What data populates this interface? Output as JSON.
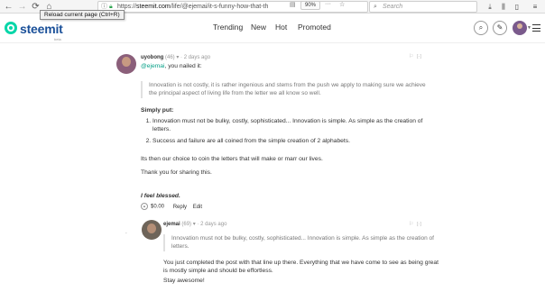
{
  "browser": {
    "url_prefix": "https://",
    "url_domain": "steemit.com",
    "url_path": "/life/@ejemai/it-s-funny-how-that-th",
    "zoom": "90%",
    "menu_dots": "···",
    "search_placeholder": "Search",
    "tooltip": "Reload current page (Ctrl+R)"
  },
  "header": {
    "logo": "steemit",
    "beta": "beta",
    "nav": [
      "Trending",
      "New",
      "Hot",
      "Promoted"
    ]
  },
  "comment1": {
    "author": "uyobong",
    "reputation": "(46)",
    "time": "2 days ago",
    "mention": "@ejemai",
    "greeting_rest": ", you nailed it:",
    "quote": "Innovation is not costly, it is rather ingenious and stems from the push we apply to making sure we achieve the principal aspect of living life from the letter we all know so well.",
    "simply_put": "Simply put:",
    "points": [
      "Innovation must not be bulky, costly, sophisticated... Innovation is simple. As simple as the creation of letters.",
      "Success and failure are all coined from the simple creation of 2 alphabets."
    ],
    "para1": "Its then our choice to coin the letters that will make or marr our lives.",
    "para2": "Thank you for sharing this.",
    "blessed": "I feel blessed.",
    "payout": "$0.00",
    "reply": "Reply",
    "edit": "Edit",
    "collapse": "[-]"
  },
  "comment2": {
    "author": "ejemai",
    "reputation": "(69)",
    "time": "2 days ago",
    "quote": "Innovation must not be bulky, costly, sophisticated... Innovation is simple. As simple as the creation of letters.",
    "body": "You just completed the post with that line up there. Everything that we have come to see as being great is mostly simple and should be effortless.",
    "closing": "Stay awesome!",
    "collapse": "[-]"
  },
  "icons": [
    "back-icon",
    "forward-icon",
    "reload-icon",
    "home-icon",
    "info-icon",
    "lock-icon",
    "search-icon",
    "download-icon",
    "library-icon",
    "sidebar-icon",
    "overflow-icon",
    "steemit-logo-icon",
    "pencil-icon",
    "flag-icon",
    "upvote-icon",
    "hamburger-icon"
  ],
  "colors": {
    "accent": "#06d6a9",
    "logo_text": "#1a5099",
    "mention": "#06a087"
  }
}
